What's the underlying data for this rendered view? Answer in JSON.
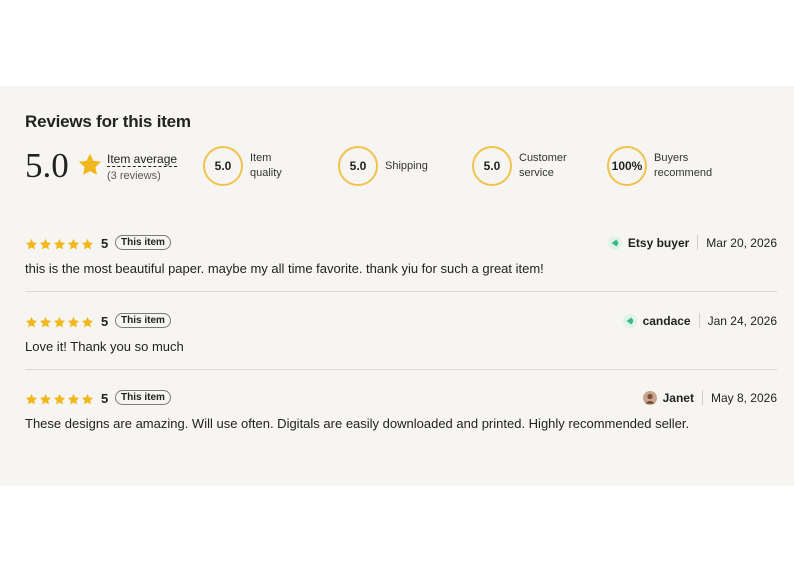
{
  "section": {
    "title": "Reviews for this item"
  },
  "summary": {
    "average_score": "5.0",
    "average_label": "Item average",
    "review_count": "(3 reviews)",
    "metrics": [
      {
        "value": "5.0",
        "label": "Item quality"
      },
      {
        "value": "5.0",
        "label": "Shipping"
      },
      {
        "value": "5.0",
        "label": "Customer\nservice"
      },
      {
        "value": "100%",
        "label": "Buyers\nrecommend"
      }
    ]
  },
  "reviews": [
    {
      "rating": 5,
      "rating_text": "5",
      "badge": "This item",
      "reviewer": "Etsy buyer",
      "date": "Mar 20, 2026",
      "text": "this is the most beautiful paper. maybe my all time favorite. thank yiu for such a great item!"
    },
    {
      "rating": 5,
      "rating_text": "5",
      "badge": "This item",
      "reviewer": "candace",
      "date": "Jan 24, 2026",
      "text": "Love it! Thank you so much"
    },
    {
      "rating": 5,
      "rating_text": "5",
      "badge": "This item",
      "reviewer": "Janet",
      "date": "May 8, 2026",
      "text": "These designs are amazing. Will use often. Digitals are easily downloaded and printed. Highly recommended seller."
    }
  ],
  "colors": {
    "star": "#f1b81e",
    "ring": "#f1c24d",
    "panel_bg": "#f7f5f1",
    "default_avatar": "#3fb983"
  }
}
